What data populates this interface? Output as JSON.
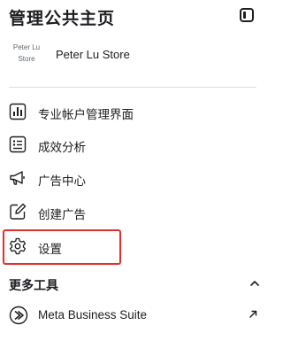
{
  "header": {
    "title": "管理公共主页",
    "collapse_icon": "sidebar-collapse-icon"
  },
  "store": {
    "avatar_line1": "Peter Lu",
    "avatar_line2": "Store",
    "name": "Peter Lu Store"
  },
  "nav": {
    "items": [
      {
        "label": "专业帐户管理界面",
        "icon": "dashboard-icon"
      },
      {
        "label": "成效分析",
        "icon": "insights-icon"
      },
      {
        "label": "广告中心",
        "icon": "megaphone-icon"
      },
      {
        "label": "创建广告",
        "icon": "edit-icon"
      },
      {
        "label": "设置",
        "icon": "gear-icon"
      }
    ],
    "highlighted_item": "设置",
    "highlight_color": "#e0302a"
  },
  "more_tools": {
    "title": "更多工具",
    "expanded": true,
    "items": [
      {
        "label": "Meta Business Suite",
        "icon": "meta-business-suite-icon",
        "external": true
      }
    ]
  }
}
